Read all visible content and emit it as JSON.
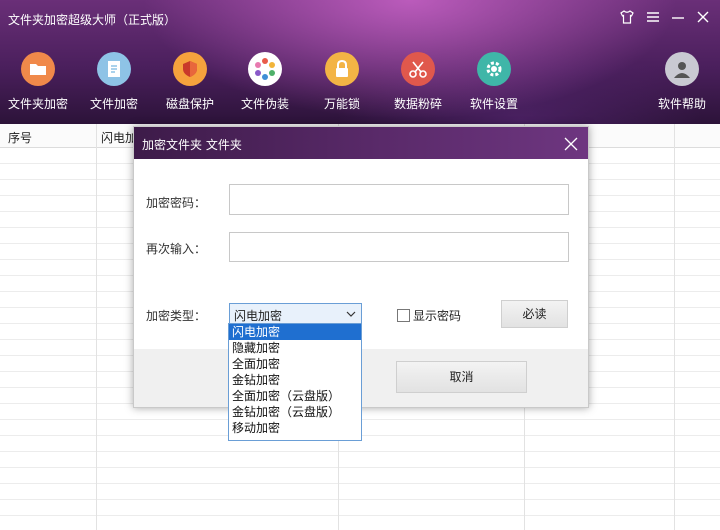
{
  "app": {
    "title": "文件夹加密超级大师（正式版）",
    "controls": {
      "skin_icon": "shirt-icon",
      "menu_icon": "menu-icon",
      "minimize_icon": "minimize-icon",
      "close_icon": "close-icon"
    }
  },
  "toolbar": {
    "items": [
      {
        "label": "文件夹加密",
        "icon": "folder-lock-icon",
        "color": "#f0894a"
      },
      {
        "label": "文件加密",
        "icon": "file-lock-icon",
        "color": "#8ec3e6"
      },
      {
        "label": "磁盘保护",
        "icon": "shield-icon",
        "color": "#f6a23d"
      },
      {
        "label": "文件伪装",
        "icon": "disguise-icon",
        "color": "#ffffff"
      },
      {
        "label": "万能锁",
        "icon": "lock-icon",
        "color": "#f3b445"
      },
      {
        "label": "数据粉碎",
        "icon": "scissors-icon",
        "color": "#e0584c"
      },
      {
        "label": "软件设置",
        "icon": "gear-icon",
        "color": "#3fb6a8"
      }
    ],
    "help": {
      "label": "软件帮助",
      "icon": "user-help-icon",
      "color": "#c9c9d2"
    }
  },
  "table": {
    "columns": [
      "序号",
      "闪电加"
    ]
  },
  "dialog": {
    "title": "加密文件夹 文件夹",
    "password_label": "加密密码：",
    "password_value": "",
    "confirm_label": "再次输入：",
    "confirm_value": "",
    "type_label": "加密类型：",
    "type_selected": "闪电加密",
    "show_password_label": "显示密码",
    "show_password_checked": false,
    "must_read_button": "必读",
    "cancel_button": "取消"
  },
  "dropdown": {
    "options": [
      "闪电加密",
      "隐藏加密",
      "全面加密",
      "金钻加密",
      "全面加密（云盘版）",
      "金钻加密（云盘版）",
      "移动加密"
    ],
    "highlighted": "闪电加密"
  }
}
